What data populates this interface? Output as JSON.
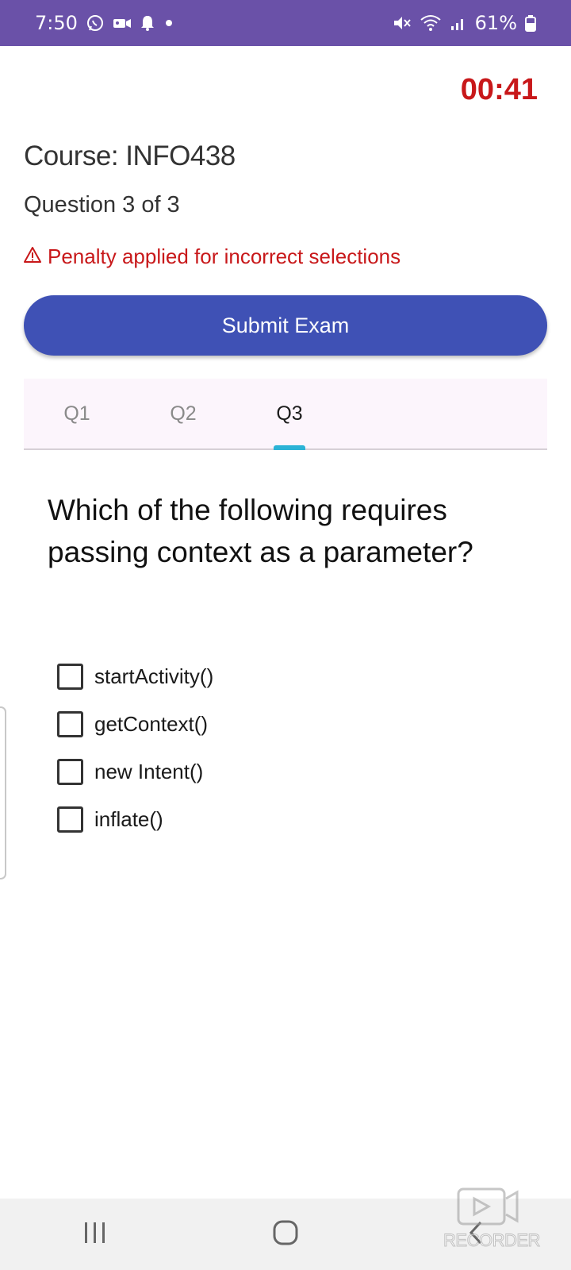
{
  "status_bar": {
    "time": "7:50",
    "battery": "61%",
    "left_icons": [
      "whatsapp-icon",
      "video-icon",
      "notification-bell-icon",
      "dot-icon"
    ],
    "right_icons": [
      "mute-icon",
      "wifi-icon",
      "signal-icon",
      "battery-icon"
    ],
    "color": "#6a51a8"
  },
  "timer": "00:41",
  "course": "Course: INFO438",
  "question_count": "Question 3 of 3",
  "penalty": {
    "icon": "warning-icon",
    "text": "Penalty applied for incorrect selections"
  },
  "submit_label": "Submit Exam",
  "tabs": [
    {
      "label": "Q1",
      "active": false
    },
    {
      "label": "Q2",
      "active": false
    },
    {
      "label": "Q3",
      "active": true
    }
  ],
  "question": "Which of the following requires passing context as a parameter?",
  "options": [
    {
      "label": "startActivity()",
      "checked": false
    },
    {
      "label": "getContext()",
      "checked": false
    },
    {
      "label": "new Intent()",
      "checked": false
    },
    {
      "label": "inflate()",
      "checked": false
    }
  ],
  "nav": {
    "icons": [
      "recent-apps-icon",
      "home-icon",
      "back-icon"
    ]
  },
  "watermark": "RECORDER",
  "colors": {
    "accent": "#3f51b5",
    "timer": "#c8181a",
    "tab_indicator": "#2bb3d6"
  }
}
